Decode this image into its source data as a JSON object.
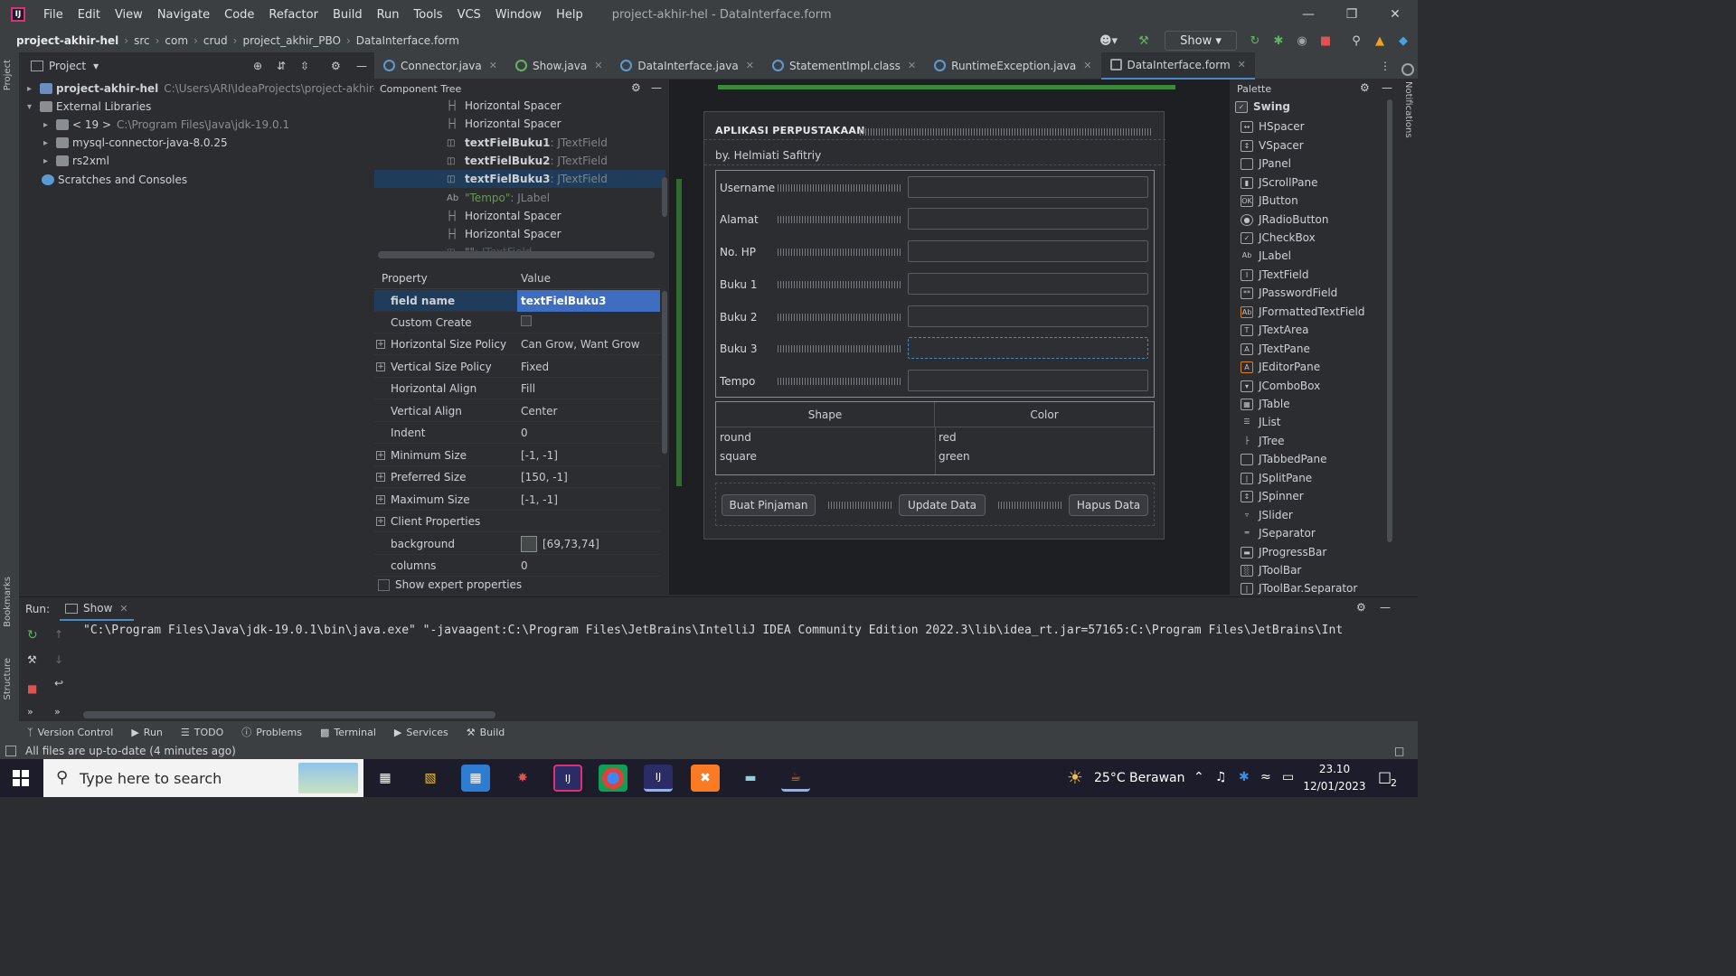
{
  "app": {
    "title": "project-akhir-hel - DataInterface.form"
  },
  "menu": [
    "File",
    "Edit",
    "View",
    "Navigate",
    "Code",
    "Refactor",
    "Build",
    "Run",
    "Tools",
    "VCS",
    "Window",
    "Help"
  ],
  "breadcrumb": [
    "project-akhir-hel",
    "src",
    "com",
    "crud",
    "project_akhir_PBO",
    "DataInterface.form"
  ],
  "toolbar": {
    "run_config": "Show"
  },
  "project_panel": {
    "title": "Project",
    "items": [
      {
        "label": "project-akhir-hel",
        "path": "C:\\Users\\ARI\\IdeaProjects\\project-akhir-hel"
      },
      {
        "label": "External Libraries"
      },
      {
        "label": "< 19 >",
        "path": "C:\\Program Files\\Java\\jdk-19.0.1"
      },
      {
        "label": "mysql-connector-java-8.0.25"
      },
      {
        "label": "rs2xml"
      },
      {
        "label": "Scratches and Consoles"
      }
    ]
  },
  "tabs": [
    {
      "label": "Connector.java"
    },
    {
      "label": "Show.java"
    },
    {
      "label": "DataInterface.java"
    },
    {
      "label": "StatementImpl.class"
    },
    {
      "label": "RuntimeException.java"
    },
    {
      "label": "DataInterface.form"
    }
  ],
  "component_tree": {
    "title": "Component Tree",
    "rows": [
      {
        "name": "Horizontal Spacer",
        "type": ""
      },
      {
        "name": "Horizontal Spacer",
        "type": ""
      },
      {
        "name": "textFielBuku1",
        "type": " : JTextField"
      },
      {
        "name": "textFielBuku2",
        "type": " : JTextField"
      },
      {
        "name": "textFielBuku3",
        "type": " : JTextField"
      },
      {
        "name": "\"Tempo\"",
        "type": " : JLabel"
      },
      {
        "name": "Horizontal Spacer",
        "type": ""
      },
      {
        "name": "Horizontal Spacer",
        "type": ""
      },
      {
        "name": "\"\"",
        "type": " : JTextField"
      }
    ]
  },
  "properties": {
    "header_property": "Property",
    "header_value": "Value",
    "rows": [
      {
        "name": "field name",
        "value": "textFielBuku3"
      },
      {
        "name": "Custom Create",
        "value": ""
      },
      {
        "name": "Horizontal Size Policy",
        "value": "Can Grow, Want Grow"
      },
      {
        "name": "Vertical Size Policy",
        "value": "Fixed"
      },
      {
        "name": "Horizontal Align",
        "value": "Fill"
      },
      {
        "name": "Vertical Align",
        "value": "Center"
      },
      {
        "name": "Indent",
        "value": "0"
      },
      {
        "name": "Minimum Size",
        "value": "[-1, -1]"
      },
      {
        "name": "Preferred Size",
        "value": "[150, -1]"
      },
      {
        "name": "Maximum Size",
        "value": "[-1, -1]"
      },
      {
        "name": "Client Properties",
        "value": ""
      },
      {
        "name": "background",
        "value": "[69,73,74]"
      },
      {
        "name": "columns",
        "value": "0"
      }
    ],
    "show_expert": "Show expert properties"
  },
  "form": {
    "title": "APLIKASI PERPUSTAKAAN",
    "subtitle": "by. Helmiati Safitriy",
    "labels": [
      "Username",
      "Alamat",
      "No. HP",
      "Buku 1",
      "Buku 2",
      "Buku 3",
      "Tempo"
    ],
    "table": {
      "headers": [
        "Shape",
        "Color"
      ],
      "rows": [
        [
          "round",
          "red"
        ],
        [
          "square",
          "green"
        ]
      ]
    },
    "buttons": [
      "Buat Pinjaman",
      "Update Data",
      "Hapus Data"
    ]
  },
  "palette": {
    "title": "Palette",
    "group": "Swing",
    "items": [
      "HSpacer",
      "VSpacer",
      "JPanel",
      "JScrollPane",
      "JButton",
      "JRadioButton",
      "JCheckBox",
      "JLabel",
      "JTextField",
      "JPasswordField",
      "JFormattedTextField",
      "JTextArea",
      "JTextPane",
      "JEditorPane",
      "JComboBox",
      "JTable",
      "JList",
      "JTree",
      "JTabbedPane",
      "JSplitPane",
      "JSpinner",
      "JSlider",
      "JSeparator",
      "JProgressBar",
      "JToolBar",
      "JToolBar.Separator"
    ]
  },
  "run_panel": {
    "label": "Run:",
    "tab": "Show",
    "output": "\"C:\\Program Files\\Java\\jdk-19.0.1\\bin\\java.exe\" \"-javaagent:C:\\Program Files\\JetBrains\\IntelliJ IDEA Community Edition 2022.3\\lib\\idea_rt.jar=57165:C:\\Program Files\\JetBrains\\Int"
  },
  "bottom_tools": [
    "Version Control",
    "Run",
    "TODO",
    "Problems",
    "Terminal",
    "Services",
    "Build"
  ],
  "side_labels": {
    "project": "Project",
    "bookmarks": "Bookmarks",
    "structure": "Structure",
    "notifications": "Notifications"
  },
  "status": "All files are up-to-date (4 minutes ago)",
  "taskbar": {
    "search_placeholder": "Type here to search",
    "weather": "25°C  Berawan",
    "time": "23.10",
    "date": "12/01/2023",
    "notif_count": "2"
  }
}
